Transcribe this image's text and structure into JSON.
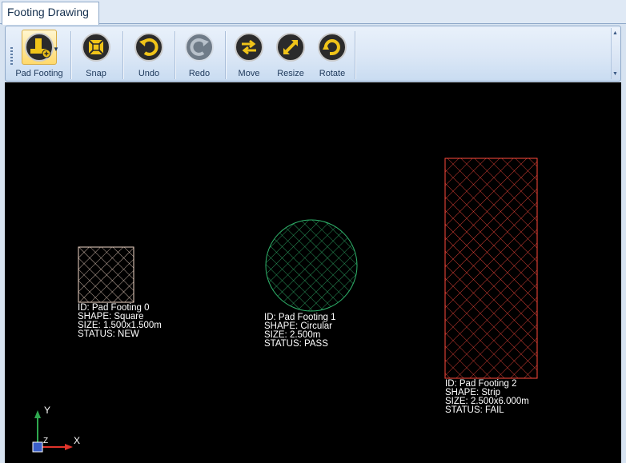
{
  "tab": {
    "label": "Footing Drawing"
  },
  "toolbar": {
    "buttons": [
      {
        "id": "pad-footing",
        "label": "Pad Footing"
      },
      {
        "id": "snap",
        "label": "Snap"
      },
      {
        "id": "undo",
        "label": "Undo"
      },
      {
        "id": "redo",
        "label": "Redo"
      },
      {
        "id": "move",
        "label": "Move"
      },
      {
        "id": "resize",
        "label": "Resize"
      },
      {
        "id": "rotate",
        "label": "Rotate"
      }
    ],
    "icons": [
      "pad-footing-icon",
      "snap-icon",
      "undo-icon",
      "redo-icon",
      "move-icon",
      "resize-icon",
      "rotate-icon"
    ]
  },
  "footings": [
    {
      "lines": [
        "ID: Pad Footing 0",
        "SHAPE: Square",
        "SIZE: 1.500x1.500m",
        "STATUS: NEW"
      ],
      "status_color": "#f2d7c7"
    },
    {
      "lines": [
        "ID: Pad Footing 1",
        "SHAPE: Circular",
        "SIZE: 2.500m",
        "STATUS: PASS"
      ],
      "status_color": "#2fb36b"
    },
    {
      "lines": [
        "ID: Pad Footing 2",
        "SHAPE: Strip",
        "SIZE: 2.500x6.000m",
        "STATUS: FAIL"
      ],
      "status_color": "#ff4a3d"
    }
  ],
  "axes": {
    "x_label": "X",
    "y_label": "Y",
    "z_label": "Z",
    "x_color": "#e0342b",
    "y_color": "#2fa84f",
    "z_color": "#3a5fc8"
  }
}
